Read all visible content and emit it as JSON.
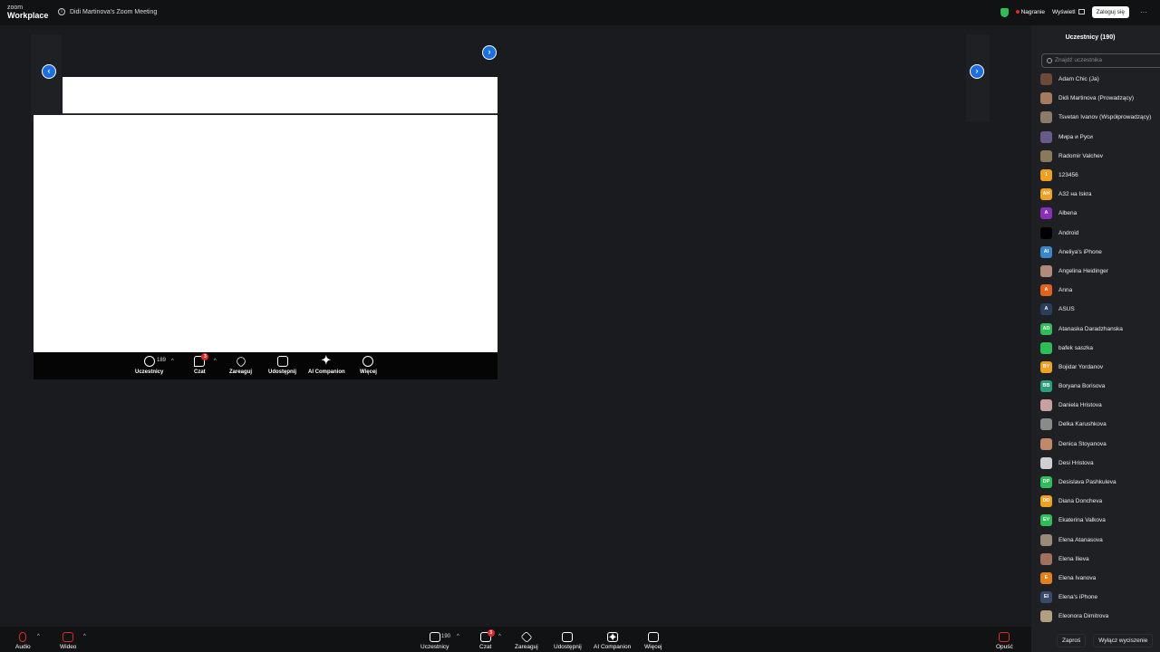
{
  "titlebar": {
    "logo_top": "zoom",
    "logo_bottom": "Workplace",
    "meeting_title": "Didi Martinova's Zoom Meeting",
    "recording_label": "Nagranie",
    "view_label": "Wyświetl",
    "login_label": "Zaloguj się",
    "more": "···"
  },
  "share_toolbar": {
    "participants_label": "Uczestnicy",
    "participants_count": "189",
    "chat_label": "Czat",
    "chat_badge": "3",
    "react_label": "Zareaguj",
    "share_label": "Udostępnij",
    "ai_label": "AI Companion",
    "more_label": "Więcej"
  },
  "nav": {
    "prev": "‹",
    "next": "›"
  },
  "panel": {
    "title": "Uczestnicy (190)",
    "search_placeholder": "Znajdź uczestnika",
    "participants": [
      {
        "name": "Adam Chic (Ja)",
        "initials": "",
        "color": "#6b4a3a"
      },
      {
        "name": "Didi Martinova (Prowadzący)",
        "initials": "",
        "color": "#a57a5e"
      },
      {
        "name": "Tsvetan Ivanov (Współprowadzący)",
        "initials": "",
        "color": "#8a7b6a"
      },
      {
        "name": "Мира и Руси",
        "initials": "",
        "color": "#6a5a8a"
      },
      {
        "name": "Radomir Valchev",
        "initials": "",
        "color": "#8a7a5a"
      },
      {
        "name": "123456",
        "initials": "1",
        "color": "#f0a020"
      },
      {
        "name": "А32 на Iskra",
        "initials": "АН",
        "color": "#f0a020"
      },
      {
        "name": "Albena",
        "initials": "A",
        "color": "#8a2fb8"
      },
      {
        "name": "Android",
        "initials": "",
        "color": "#000000"
      },
      {
        "name": "Aneliya's iPhone",
        "initials": "AI",
        "color": "#3a86c8"
      },
      {
        "name": "Angelina Heidinger",
        "initials": "",
        "color": "#b08a7a"
      },
      {
        "name": "Anna",
        "initials": "A",
        "color": "#e2611c"
      },
      {
        "name": "ASUS",
        "initials": "A",
        "color": "#2c3e5a"
      },
      {
        "name": "Atanaska Daradzhanska",
        "initials": "AD",
        "color": "#2ebd59"
      },
      {
        "name": "bafek saszka",
        "initials": "",
        "color": "#2ebd59"
      },
      {
        "name": "Bojidar Yordanov",
        "initials": "BY",
        "color": "#f0a020"
      },
      {
        "name": "Boryana Borisova",
        "initials": "BB",
        "color": "#2aa07a"
      },
      {
        "name": "Daniela Hristova",
        "initials": "",
        "color": "#c8a0a0"
      },
      {
        "name": "Delka Karushkova",
        "initials": "",
        "color": "#8a8a8a"
      },
      {
        "name": "Denica Stoyanova",
        "initials": "",
        "color": "#c08a6a"
      },
      {
        "name": "Desi Hristova",
        "initials": "",
        "color": "#d0d0d0"
      },
      {
        "name": "Desislava Pashkuleva",
        "initials": "DP",
        "color": "#2ebd59"
      },
      {
        "name": "Diana Doncheva",
        "initials": "DD",
        "color": "#f0a020"
      },
      {
        "name": "Ekaterina Valkova",
        "initials": "EV",
        "color": "#2ebd59"
      },
      {
        "name": "Elena Atanasova",
        "initials": "",
        "color": "#9a8a7a"
      },
      {
        "name": "Elena Ilieva",
        "initials": "",
        "color": "#a07060"
      },
      {
        "name": "Elena Ivanova",
        "initials": "E",
        "color": "#e2811c"
      },
      {
        "name": "Elena's iPhone",
        "initials": "EI",
        "color": "#3a4a6a"
      },
      {
        "name": "Eleonora Dimitrova",
        "initials": "",
        "color": "#b0a080"
      }
    ],
    "invite_label": "Zaproś",
    "mute_all_label": "Wyłącz wyciszenie"
  },
  "bottombar": {
    "audio_label": "Audio",
    "video_label": "Wideo",
    "participants_label": "Uczestnicy",
    "participants_count": "190",
    "chat_label": "Czat",
    "chat_badge": "3",
    "react_label": "Zareaguj",
    "share_label": "Udostępnij",
    "ai_label": "AI Companion",
    "more_label": "Więcej",
    "leave_label": "Opuść"
  }
}
